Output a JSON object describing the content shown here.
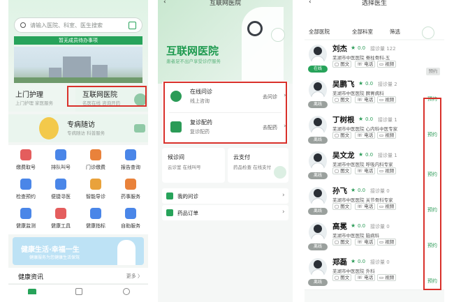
{
  "panel1": {
    "search_placeholder": "请输入医院、科室、医生搜索",
    "notice": "暂无成员待办事项",
    "home_care": {
      "title": "上门护理",
      "sub": "上门护理 家医服务"
    },
    "internet_hospital": {
      "title": "互联网医院",
      "sub": "名医在线 咨询开药"
    },
    "chronic": {
      "title": "专病随访",
      "sub": "专病随访 科普服务"
    },
    "grid": [
      {
        "label": "缴费取号",
        "color": "#e45d5d",
        "icon": "receipt-icon"
      },
      {
        "label": "排队叫号",
        "color": "#4a86e8",
        "icon": "queue-icon"
      },
      {
        "label": "门诊缴费",
        "color": "#e9823b",
        "icon": "payment-icon"
      },
      {
        "label": "报告查询",
        "color": "#4a86e8",
        "icon": "report-icon"
      },
      {
        "label": "检查预约",
        "color": "#4a86e8",
        "icon": "calendar-icon"
      },
      {
        "label": "便捷寻医",
        "color": "#4a86e8",
        "icon": "doctor-icon"
      },
      {
        "label": "智能导诊",
        "color": "#e9a23b",
        "icon": "guide-icon"
      },
      {
        "label": "药事服务",
        "color": "#e9823b",
        "icon": "pharmacy-icon"
      },
      {
        "label": "健康监测",
        "color": "#4a86e8",
        "icon": "heart-icon"
      },
      {
        "label": "健康工具",
        "color": "#e45d5d",
        "icon": "toolbox-icon"
      },
      {
        "label": "健康指标",
        "color": "#4a86e8",
        "icon": "chart-icon"
      },
      {
        "label": "自助服务",
        "color": "#4a86e8",
        "icon": "self-service-icon"
      }
    ],
    "banner_title": "健康生活·幸福一生",
    "banner_sub": "健康服务为您健康生活保驾",
    "news_title": "健康资讯",
    "news_more": "更多 〉"
  },
  "panel2": {
    "title": "互联网医院",
    "brand": "互联网医院",
    "slogan": "患者足不出户享受诊疗服务",
    "items": [
      {
        "title": "在线问诊",
        "sub": "线上咨询",
        "go": "去问诊"
      },
      {
        "title": "复诊配药",
        "sub": "复诊配药",
        "go": "去配药"
      }
    ],
    "wait": {
      "title": "候诊间",
      "sub": "云诊室 在线叫号"
    },
    "pay": {
      "title": "云支付",
      "sub": "药品检查 在线支付"
    },
    "my_consult": "我的问诊",
    "drug_order": "药品订单"
  },
  "panel3": {
    "title": "选择医生",
    "filters": [
      "全部医院",
      "全部科室",
      "筛选"
    ],
    "doctors": [
      {
        "name": "刘杰",
        "score": "0.0",
        "consult": "接诊量 122",
        "dept": "芜湖市中医医院 脊柱骨科-五",
        "status": "在线",
        "online": true,
        "book": "预约",
        "booked_grey": true
      },
      {
        "name": "吴鹏飞",
        "score": "0.0",
        "consult": "接诊量 2",
        "dept": "芜湖市中医医院 脾胃病科",
        "status": "离线",
        "online": false,
        "book": "预约",
        "booked_grey": false
      },
      {
        "name": "丁树根",
        "score": "0.0",
        "consult": "接诊量 1",
        "dept": "芜湖市中医医院 心内科中医专家",
        "status": "离线",
        "online": false,
        "book": "预约",
        "booked_grey": false
      },
      {
        "name": "吴文龙",
        "score": "0.0",
        "consult": "接诊量 1",
        "dept": "芜湖市中医医院 呼吸内科专家",
        "status": "离线",
        "online": false,
        "book": "预约",
        "booked_grey": false
      },
      {
        "name": "孙飞",
        "score": "0.0",
        "consult": "接诊量 0",
        "dept": "芜湖市中医医院 关节骨科专家",
        "status": "离线",
        "online": false,
        "book": "预约",
        "booked_grey": false
      },
      {
        "name": "高冕",
        "score": "0.0",
        "consult": "接诊量 0",
        "dept": "芜湖市中医医院 脑病科",
        "status": "离线",
        "online": false,
        "book": "预约",
        "booked_grey": false
      },
      {
        "name": "郑磊",
        "score": "0.0",
        "consult": "接诊量 0",
        "dept": "芜湖市中医医院 外科",
        "status": "离线",
        "online": false,
        "book": "预约",
        "booked_grey": false
      }
    ],
    "chip_text": "图文",
    "chip_phone": "电话",
    "chip_video": "视频"
  },
  "colors": {
    "accent": "#27a35a",
    "highlight": "#d9302a"
  }
}
